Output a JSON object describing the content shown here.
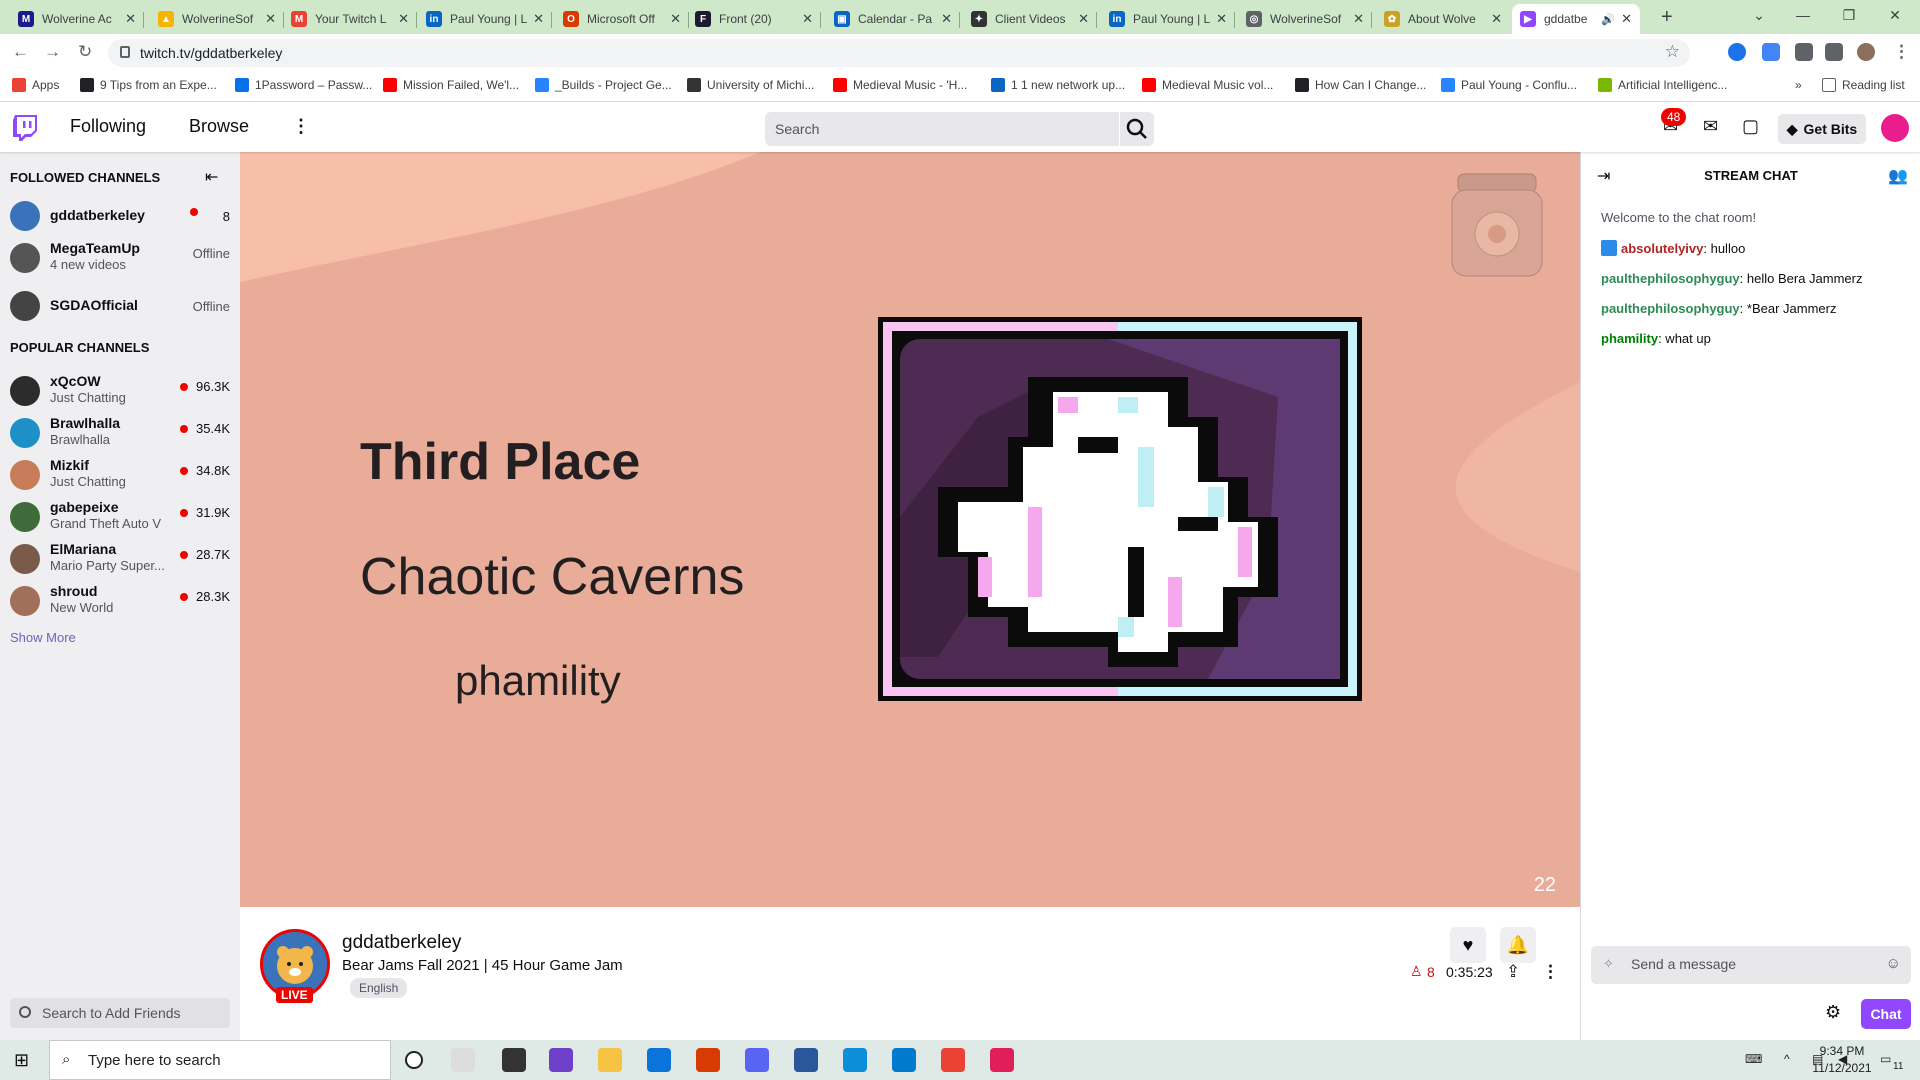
{
  "browser": {
    "tabs": [
      {
        "title": "Wolverine Ac",
        "color": "#1a1a8c",
        "glyph": "M"
      },
      {
        "title": "WolverineSof",
        "color": "#f4b400",
        "glyph": "▲"
      },
      {
        "title": "Your Twitch L",
        "color": "#ea4335",
        "glyph": "M"
      },
      {
        "title": "Paul Young | L",
        "color": "#0a66c2",
        "glyph": "in"
      },
      {
        "title": "Microsoft Off",
        "color": "#d83b01",
        "glyph": "O"
      },
      {
        "title": "Front (20)",
        "color": "#1b1b2f",
        "glyph": "F"
      },
      {
        "title": "Calendar - Pa",
        "color": "#0a66c2",
        "glyph": "▣"
      },
      {
        "title": "Client Videos",
        "color": "#333333",
        "glyph": "✦"
      },
      {
        "title": "Paul Young | L",
        "color": "#0a66c2",
        "glyph": "in"
      },
      {
        "title": "WolverineSof",
        "color": "#5f6368",
        "glyph": "◎"
      },
      {
        "title": "About Wolve",
        "color": "#c9a227",
        "glyph": "✿"
      },
      {
        "title": "gddatbe",
        "color": "#9147ff",
        "glyph": "▶"
      }
    ],
    "url": "twitch.tv/gddatberkeley",
    "bookmarks": [
      {
        "label": "Apps",
        "color": "#ea4335"
      },
      {
        "label": "9 Tips from an Expe...",
        "color": "#202124"
      },
      {
        "label": "1Password – Passw...",
        "color": "#0572ec"
      },
      {
        "label": "Mission Failed, We'l...",
        "color": "#ff0000"
      },
      {
        "label": "_Builds - Project Ge...",
        "color": "#2684ff"
      },
      {
        "label": "University of Michi...",
        "color": "#333333"
      },
      {
        "label": "Medieval Music - 'H...",
        "color": "#ff0000"
      },
      {
        "label": "1 1 new network up...",
        "color": "#0a66c2"
      },
      {
        "label": "Medieval Music vol...",
        "color": "#ff0000"
      },
      {
        "label": "How Can I Change...",
        "color": "#202124"
      },
      {
        "label": "Paul Young - Conflu...",
        "color": "#2684ff"
      },
      {
        "label": "Artificial Intelligenc...",
        "color": "#76b900"
      }
    ],
    "reading_list": "Reading list"
  },
  "twitch": {
    "nav": {
      "following": "Following",
      "browse": "Browse"
    },
    "search_placeholder": "Search",
    "notifications_count": "48",
    "get_bits": "Get Bits",
    "accent": "#9147ff",
    "sidebar": {
      "followed_header": "FOLLOWED CHANNELS",
      "followed": [
        {
          "name": "gddatberkeley",
          "sub": "",
          "viewers": "8",
          "live": true,
          "color": "#3a73b9"
        },
        {
          "name": "MegaTeamUp",
          "sub": "4 new videos",
          "viewers": "Offline",
          "live": false,
          "color": "#555"
        },
        {
          "name": "SGDAOfficial",
          "sub": "",
          "viewers": "Offline",
          "live": false,
          "color": "#444"
        }
      ],
      "popular_header": "POPULAR CHANNELS",
      "popular": [
        {
          "name": "xQcOW",
          "sub": "Just Chatting",
          "viewers": "96.3K",
          "color": "#2c2c2c"
        },
        {
          "name": "Brawlhalla",
          "sub": "Brawlhalla",
          "viewers": "35.4K",
          "color": "#1e90c8"
        },
        {
          "name": "Mizkif",
          "sub": "Just Chatting",
          "viewers": "34.8K",
          "color": "#c77d5a"
        },
        {
          "name": "gabepeixe",
          "sub": "Grand Theft Auto V",
          "viewers": "31.9K",
          "color": "#3f6b3a"
        },
        {
          "name": "ElMariana",
          "sub": "Mario Party Super...",
          "viewers": "28.7K",
          "color": "#7a5b4a"
        },
        {
          "name": "shroud",
          "sub": "New World",
          "viewers": "28.3K",
          "color": "#a0705a"
        }
      ],
      "show_more": "Show More",
      "friends_placeholder": "Search to Add Friends"
    },
    "stream": {
      "slide_title": "Third Place",
      "slide_game": "Chaotic Caverns",
      "slide_name": "phamility",
      "slide_number": "22",
      "channel": "gddatberkeley",
      "title": "Bear Jams Fall 2021 | 45 Hour Game Jam",
      "tag": "English",
      "live_label": "LIVE",
      "viewers": "8",
      "uptime": "0:35:23"
    },
    "chat": {
      "header": "STREAM CHAT",
      "welcome": "Welcome to the chat room!",
      "messages": [
        {
          "user": "absolutelyivy",
          "text": ": hulloo",
          "color": "#b22222"
        },
        {
          "user": "paulthephilosophyguy",
          "text": ": hello Bera Jammerz",
          "color": "#2e8b57"
        },
        {
          "user": "paulthephilosophyguy",
          "text": ": *Bear Jammerz",
          "color": "#2e8b57"
        },
        {
          "user": "phamility",
          "text": ": what up",
          "color": "#008000"
        }
      ],
      "input_placeholder": "Send a message",
      "send_label": "Chat"
    }
  },
  "taskbar": {
    "search_placeholder": "Type here to search",
    "time": "9:34 PM",
    "date": "11/12/2021",
    "notif_count": "11"
  }
}
